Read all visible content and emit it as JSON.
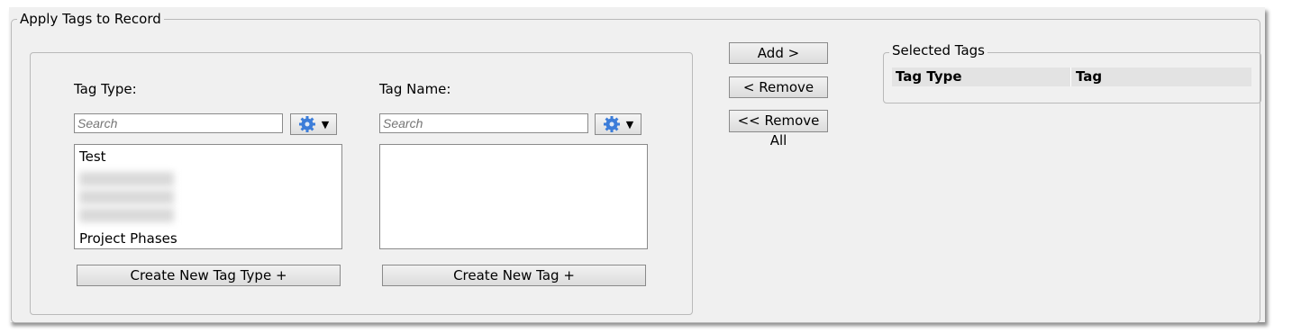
{
  "group_title": "Apply Tags to Record",
  "tag_type": {
    "label": "Tag Type:",
    "search_placeholder": "Search",
    "items": [
      "Test",
      "Project Phases"
    ],
    "create_button": "Create New Tag Type +"
  },
  "tag_name": {
    "label": "Tag Name:",
    "search_placeholder": "Search",
    "items": [],
    "create_button": "Create New Tag +"
  },
  "actions": {
    "add": "Add >",
    "remove": "< Remove",
    "remove_all": "<< Remove All"
  },
  "selected": {
    "title": "Selected Tags",
    "columns": [
      "Tag Type",
      "Tag"
    ]
  },
  "colors": {
    "gear_blue": "#3c7dd9",
    "panel_bg": "#f0f0f0"
  }
}
